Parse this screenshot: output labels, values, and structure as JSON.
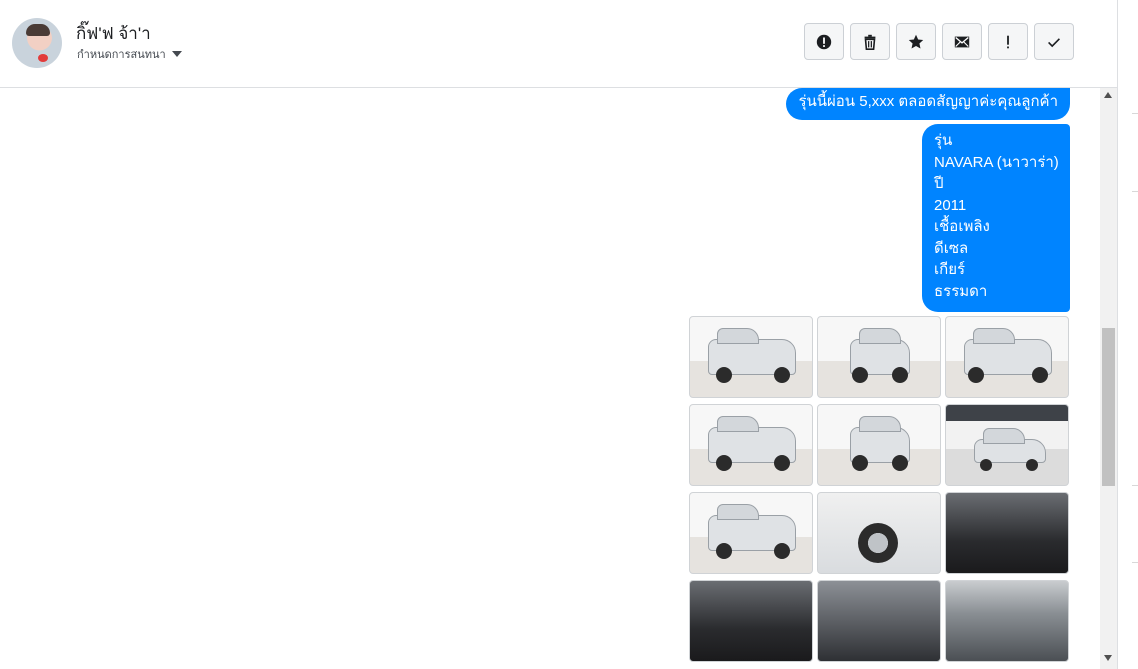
{
  "header": {
    "contact_name": "กิ๊ฟ'ฟ จ้า'า",
    "subtitle": "กำหนดการสนทนา"
  },
  "toolbar": {
    "buttons": [
      {
        "icon": "alert-circle-icon",
        "label": "report"
      },
      {
        "icon": "trash-icon",
        "label": "delete"
      },
      {
        "icon": "star-icon",
        "label": "star"
      },
      {
        "icon": "envelope-icon",
        "label": "mark-unread"
      },
      {
        "icon": "exclamation-icon",
        "label": "spam"
      },
      {
        "icon": "checkmark-icon",
        "label": "done"
      }
    ]
  },
  "messages": {
    "m1": "รุ่นนี้ผ่อน 5,xxx ตลอดสัญญาค่ะคุณลูกค้า",
    "m2_lines": [
      "รุ่น",
      "NAVARA (นาวาร่า)",
      "ปี",
      "2011",
      "เชื้อเพลิง",
      "ดีเซล",
      "เกียร์",
      "ธรรมดา"
    ]
  },
  "photos": [
    {
      "kind": "truck-front-left"
    },
    {
      "kind": "truck-front"
    },
    {
      "kind": "truck-rear-right"
    },
    {
      "kind": "truck-front-left"
    },
    {
      "kind": "truck-rear"
    },
    {
      "kind": "truck-side"
    },
    {
      "kind": "truck-rear-left"
    },
    {
      "kind": "wheel-closeup"
    },
    {
      "kind": "gear-shift"
    },
    {
      "kind": "interior-dashboard"
    },
    {
      "kind": "steering-console"
    },
    {
      "kind": "engine-bay"
    }
  ],
  "colors": {
    "bubble": "#0084ff",
    "bubble_text": "#ffffff",
    "border": "#dddfe2"
  }
}
